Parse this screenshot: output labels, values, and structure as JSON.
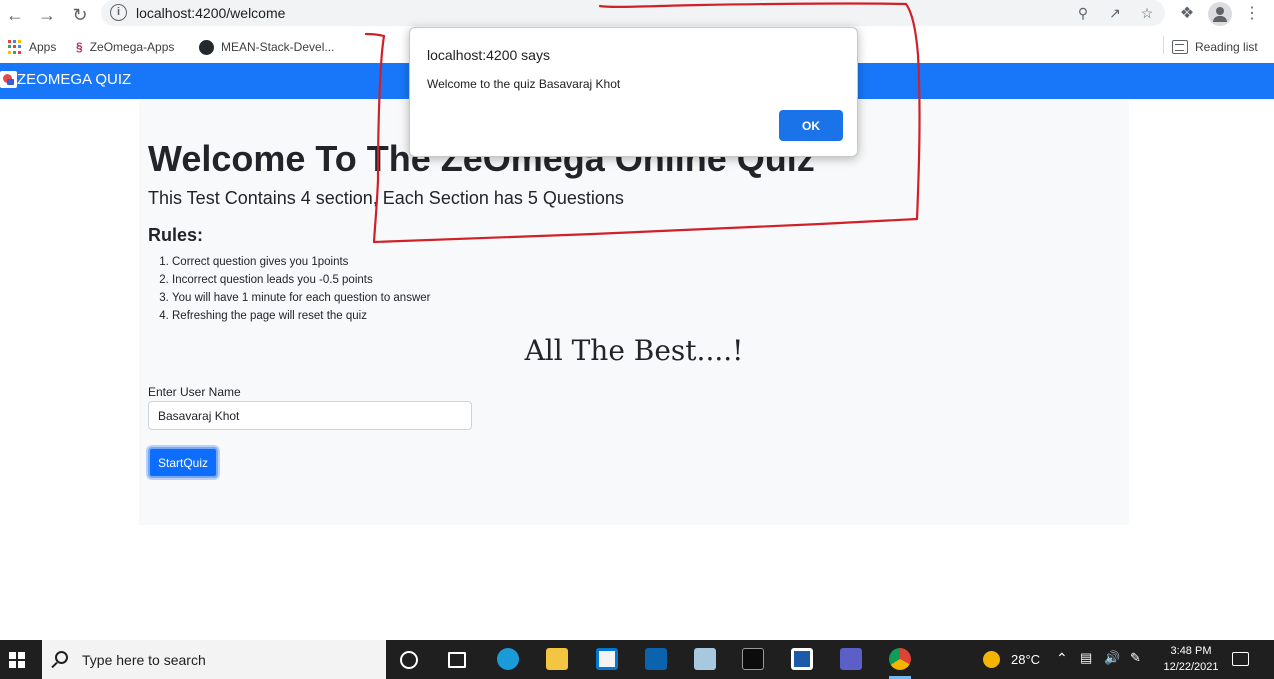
{
  "browser": {
    "url": "localhost:4200/welcome",
    "bookmarks": [
      {
        "label": "Apps",
        "icon": "apps-grid-icon"
      },
      {
        "label": "ZeOmega-Apps",
        "icon": "zeomega-favicon"
      },
      {
        "label": "MEAN-Stack-Devel...",
        "icon": "github-icon"
      }
    ],
    "reading_list": "Reading list"
  },
  "app": {
    "brand": "ZEOMEGA QUIZ",
    "title": "Welcome To The ZeOmega Online Quiz",
    "subtitle": "This Test Contains 4 section, Each Section has 5 Questions",
    "rules_heading": "Rules:",
    "rules": [
      "Correct question gives you 1points",
      "Incorrect question leads you -0.5 points",
      "You will have 1 minute for each question to answer",
      "Refreshing the page will reset the quiz"
    ],
    "best_wishes": "All The Best....!",
    "username_label": "Enter User Name",
    "username_value": "Basavaraj Khot",
    "start_button": "StartQuiz"
  },
  "dialog": {
    "origin": "localhost:4200 says",
    "message": "Welcome to the quiz Basavaraj Khot",
    "ok_label": "OK"
  },
  "taskbar": {
    "search_placeholder": "Type here to search",
    "temperature": "28°C",
    "time": "3:48 PM",
    "date": "12/22/2021"
  },
  "colors": {
    "app_nav": "#1877f9",
    "primary_button": "#0d6efd",
    "dialog_ok": "#1a73e8",
    "annotation_red": "#d0202a"
  }
}
